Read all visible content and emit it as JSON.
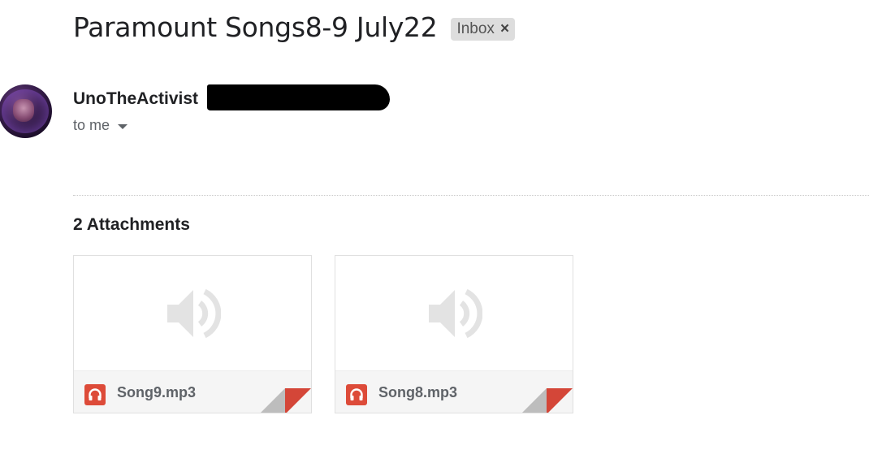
{
  "email": {
    "subject": "Paramount Songs8-9 July22",
    "label": "Inbox",
    "label_remove_glyph": "×",
    "sender_name": "UnoTheActivist",
    "recipient_text": "to me"
  },
  "attachments": {
    "title": "2 Attachments",
    "items": [
      {
        "name": "Song9.mp3",
        "type_icon": "audio-file-icon",
        "preview_icon": "speaker-icon"
      },
      {
        "name": "Song8.mp3",
        "type_icon": "audio-file-icon",
        "preview_icon": "speaker-icon"
      }
    ]
  },
  "colors": {
    "file_icon": "#dd4b39",
    "fold_corner": "#d44638",
    "chip_bg": "#dddddd",
    "speaker": "#e3e3e3"
  }
}
